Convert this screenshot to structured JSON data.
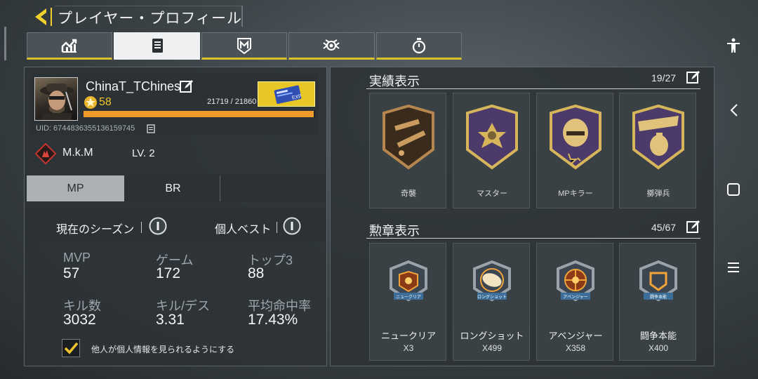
{
  "header": {
    "title": "プレイヤー・プロフィール"
  },
  "tabs": [
    {
      "icon": "stats-chart-icon",
      "active": false
    },
    {
      "icon": "document-list-icon",
      "active": true
    },
    {
      "icon": "badge-shield-icon",
      "active": false
    },
    {
      "icon": "emblem-icon",
      "active": false
    },
    {
      "icon": "stopwatch-icon",
      "active": false
    }
  ],
  "profile": {
    "username": "ChinaT_TChines",
    "level": "58",
    "xp_text": "21719 / 21860",
    "xp_progress": 0.9935,
    "uid": "UID: 6744836355136159745",
    "clan_name": "M.k.M",
    "clan_level": "LV. 2"
  },
  "modes": {
    "mp": "MP",
    "br": "BR"
  },
  "season": {
    "current_label": "現在のシーズン",
    "best_label": "個人ベスト"
  },
  "stats": [
    {
      "label": "MVP",
      "value": "57"
    },
    {
      "label": "ゲーム",
      "value": "172"
    },
    {
      "label": "トップ3",
      "value": "88"
    },
    {
      "label": "キル数",
      "value": "3032"
    },
    {
      "label": "キル/デス",
      "value": "3.31"
    },
    {
      "label": "平均命中率",
      "value": "17.43%"
    }
  ],
  "privacy": {
    "label": "他人が個人情報を見られるようにする",
    "checked": true
  },
  "achievements": {
    "title": "実績表示",
    "count": "19/27",
    "items": [
      {
        "name": "奇襲",
        "icon": "shovel-launcher-icon"
      },
      {
        "name": "マスター",
        "icon": "cross-medal-icon"
      },
      {
        "name": "MPキラー",
        "icon": "skull-helmet-icon"
      },
      {
        "name": "擲弾兵",
        "icon": "grenade-boom-icon"
      }
    ]
  },
  "medals": {
    "title": "勲章表示",
    "count": "45/67",
    "items": [
      {
        "name": "ニュークリア",
        "count": "X3",
        "banner": "ニュークリア"
      },
      {
        "name": "ロングショット",
        "count": "X499",
        "banner": "ロングショット"
      },
      {
        "name": "アベンジャー",
        "count": "X358",
        "banner": "アベンジャー"
      },
      {
        "name": "闘争本能",
        "count": "X400",
        "banner": "闘争本能"
      }
    ]
  },
  "colors": {
    "accent": "#e7c626",
    "xp": "#f09a2b",
    "gold": "#f0c42c"
  }
}
